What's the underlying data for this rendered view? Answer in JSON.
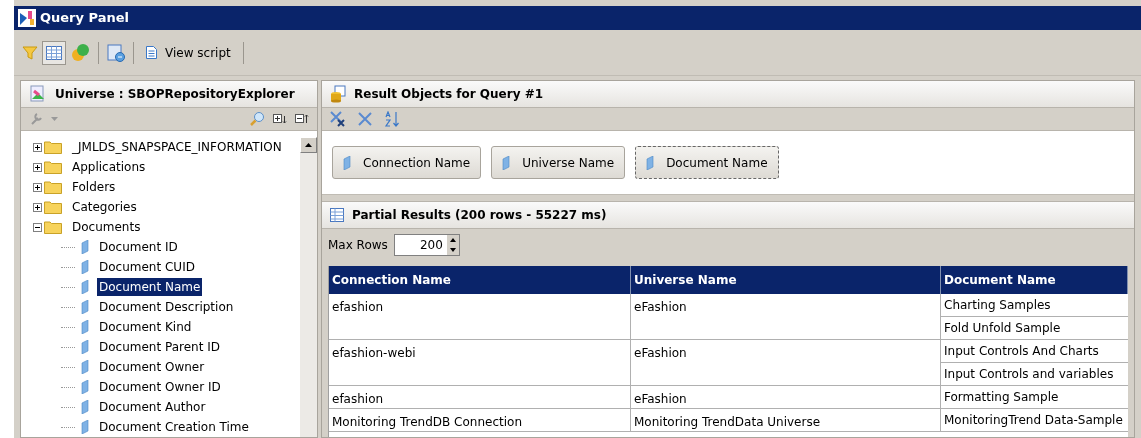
{
  "window": {
    "title": "Query Panel"
  },
  "toolbar": {
    "view_script": "View script",
    "grid_view_selected": true
  },
  "universe_panel": {
    "title": "Universe : SBOPRepositoryExplorer",
    "tree": [
      {
        "label": "_JMLDS_SNAPSPACE_INFORMATION",
        "kind": "folder",
        "expanded": false,
        "selected": false
      },
      {
        "label": "Applications",
        "kind": "folder",
        "expanded": false,
        "selected": false
      },
      {
        "label": "Folders",
        "kind": "folder",
        "expanded": false,
        "selected": false
      },
      {
        "label": "Categories",
        "kind": "folder",
        "expanded": false,
        "selected": false
      },
      {
        "label": "Documents",
        "kind": "folder",
        "expanded": true,
        "selected": false,
        "children": [
          {
            "label": "Document ID",
            "kind": "object",
            "selected": false
          },
          {
            "label": "Document CUID",
            "kind": "object",
            "selected": false
          },
          {
            "label": "Document Name",
            "kind": "object",
            "selected": true
          },
          {
            "label": "Document Description",
            "kind": "object",
            "selected": false
          },
          {
            "label": "Document Kind",
            "kind": "object",
            "selected": false
          },
          {
            "label": "Document Parent ID",
            "kind": "object",
            "selected": false
          },
          {
            "label": "Document Owner",
            "kind": "object",
            "selected": false
          },
          {
            "label": "Document Owner ID",
            "kind": "object",
            "selected": false
          },
          {
            "label": "Document Author",
            "kind": "object",
            "selected": false
          },
          {
            "label": "Document Creation Time",
            "kind": "object",
            "selected": false
          }
        ]
      }
    ]
  },
  "result_objects": {
    "title": "Result Objects for Query #1",
    "objects": [
      {
        "label": "Connection Name",
        "selected": false
      },
      {
        "label": "Universe Name",
        "selected": false
      },
      {
        "label": "Document Name",
        "selected": true
      }
    ]
  },
  "partial_results": {
    "title": "Partial Results (200 rows - 55227 ms)",
    "max_rows_label": "Max Rows",
    "max_rows": "200",
    "columns": [
      "Connection Name",
      "Universe Name",
      "Document Name"
    ],
    "rows": [
      {
        "connection": "efashion",
        "universe": "eFashion",
        "documents": [
          "Charting Samples",
          "Fold Unfold Sample"
        ]
      },
      {
        "connection": "efashion-webi",
        "universe": "eFashion",
        "documents": [
          "Input Controls And Charts",
          "Input Controls and variables"
        ]
      },
      {
        "connection": "efashion",
        "universe": "eFashion",
        "documents": [
          "Formatting Sample"
        ]
      },
      {
        "connection": "Monitoring TrendDB Connection",
        "universe": "Monitoring TrendData Universe",
        "documents": [
          "MonitoringTrend Data-Sample"
        ]
      }
    ]
  }
}
